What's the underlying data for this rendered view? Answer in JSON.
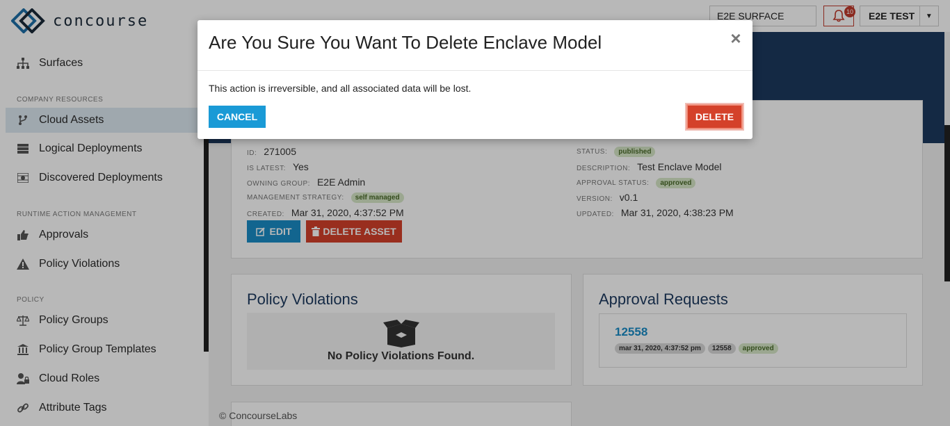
{
  "app": {
    "name": "concourse"
  },
  "sidebar": {
    "top_item": {
      "label": "Surfaces",
      "icon": "sitemap-icon"
    },
    "sections": [
      {
        "title": "COMPANY RESOURCES",
        "items": [
          {
            "label": "Cloud Assets",
            "icon": "branch-icon",
            "active": true
          },
          {
            "label": "Logical Deployments",
            "icon": "server-icon"
          },
          {
            "label": "Discovered Deployments",
            "icon": "discover-icon"
          }
        ]
      },
      {
        "title": "RUNTIME ACTION MANAGEMENT",
        "items": [
          {
            "label": "Approvals",
            "icon": "thumbs-up-icon"
          },
          {
            "label": "Policy Violations",
            "icon": "warning-icon"
          }
        ]
      },
      {
        "title": "POLICY",
        "items": [
          {
            "label": "Policy Groups",
            "icon": "balance-scale-icon"
          },
          {
            "label": "Policy Group Templates",
            "icon": "institution-icon"
          },
          {
            "label": "Cloud Roles",
            "icon": "user-lock-icon"
          },
          {
            "label": "Attribute Tags",
            "icon": "link-icon"
          }
        ]
      }
    ]
  },
  "topbar": {
    "surface": "E2E SURFACE",
    "notification_count": "10",
    "user": "E2E TEST"
  },
  "asset": {
    "left": [
      {
        "key": "ID:",
        "value": "271005"
      },
      {
        "key": "IS LATEST:",
        "value": "Yes"
      },
      {
        "key": "OWNING GROUP:",
        "value": "E2E Admin"
      },
      {
        "key": "MANAGEMENT STRATEGY:",
        "value": "self managed"
      },
      {
        "key": "CREATED:",
        "value": "Mar 31, 2020, 4:37:52 PM"
      }
    ],
    "right": [
      {
        "key": "STATUS:",
        "value": "published"
      },
      {
        "key": "DESCRIPTION:",
        "value": "Test Enclave Model"
      },
      {
        "key": "APPROVAL STATUS:",
        "value": "approved"
      },
      {
        "key": "VERSION:",
        "value": "v0.1"
      },
      {
        "key": "UPDATED:",
        "value": "Mar 31, 2020, 4:38:23 PM"
      }
    ],
    "edit_label": "EDIT",
    "delete_label": "DELETE ASSET"
  },
  "policy_violations": {
    "title": "Policy Violations",
    "empty_text": "No Policy Violations Found."
  },
  "approval_requests": {
    "title": "Approval Requests",
    "request": {
      "id": "12558",
      "date": "mar 31, 2020, 4:37:52 pm",
      "number": "12558",
      "status": "approved"
    }
  },
  "footer": "© ConcourseLabs",
  "modal": {
    "title": "Are You Sure You Want To Delete Enclave Model",
    "close": "×",
    "body": "This action is irreversible, and all associated data will be lost.",
    "cancel_label": "CANCEL",
    "delete_label": "DELETE"
  }
}
